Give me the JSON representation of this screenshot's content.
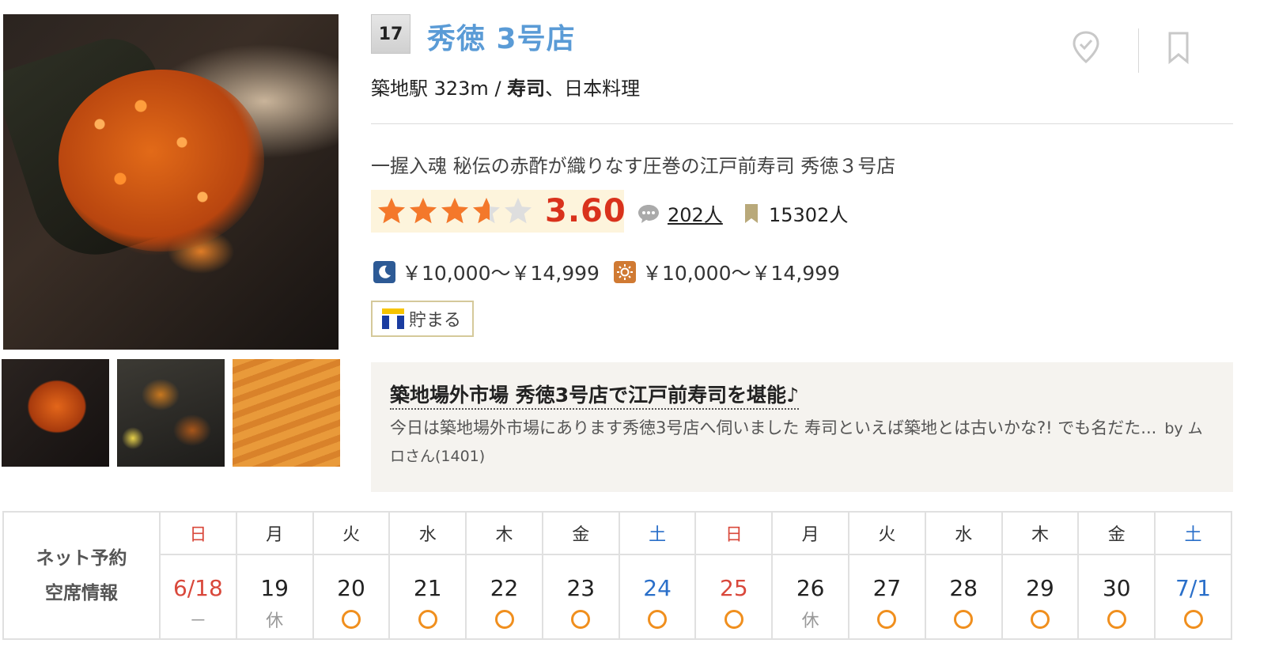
{
  "shop": {
    "rank": "17",
    "name": "秀徳 3号店",
    "station_distance": "築地駅 323m /",
    "genre_main": "寿司",
    "genre_rest": "、日本料理",
    "catch_copy": "一握入魂 秘伝の赤酢が織りなす圧巻の江戸前寿司 秀徳３号店"
  },
  "rating": {
    "value": "3.60",
    "stars": 3.6,
    "review_count": "202人",
    "bookmark_count": "15302人",
    "star_color": "#f4782a"
  },
  "price": {
    "dinner": "￥10,000～￥14,999",
    "lunch": "￥10,000～￥14,999"
  },
  "tpoint": {
    "label": "貯まる"
  },
  "review": {
    "title": "築地場外市場 秀徳3号店で江戸前寿司を堪能♪",
    "body": "今日は築地場外市場にあります秀徳3号店へ伺いました 寿司といえば築地とは古いかな?! でも名だた...",
    "by": "by ムロさん(1401)"
  },
  "calendar": {
    "label_line1": "ネット予約",
    "label_line2": "空席情報",
    "days": [
      {
        "dow": "日",
        "date": "6/18",
        "status": "－",
        "color": "red"
      },
      {
        "dow": "月",
        "date": "19",
        "status": "休",
        "color": ""
      },
      {
        "dow": "火",
        "date": "20",
        "status": "circle",
        "color": ""
      },
      {
        "dow": "水",
        "date": "21",
        "status": "circle",
        "color": ""
      },
      {
        "dow": "木",
        "date": "22",
        "status": "circle",
        "color": ""
      },
      {
        "dow": "金",
        "date": "23",
        "status": "circle",
        "color": ""
      },
      {
        "dow": "土",
        "date": "24",
        "status": "circle",
        "color": "blue"
      },
      {
        "dow": "日",
        "date": "25",
        "status": "circle",
        "color": "red"
      },
      {
        "dow": "月",
        "date": "26",
        "status": "休",
        "color": ""
      },
      {
        "dow": "火",
        "date": "27",
        "status": "circle",
        "color": ""
      },
      {
        "dow": "水",
        "date": "28",
        "status": "circle",
        "color": ""
      },
      {
        "dow": "木",
        "date": "29",
        "status": "circle",
        "color": ""
      },
      {
        "dow": "金",
        "date": "30",
        "status": "circle",
        "color": ""
      },
      {
        "dow": "土",
        "date": "7/1",
        "status": "circle",
        "color": "blue"
      }
    ]
  },
  "icons": {
    "visited": "map-pin-check-icon",
    "save": "bookmark-icon",
    "dinner": "moon-icon",
    "lunch": "sun-icon",
    "review": "speech-bubble-icon",
    "bookmark": "bookmark-small-icon"
  }
}
